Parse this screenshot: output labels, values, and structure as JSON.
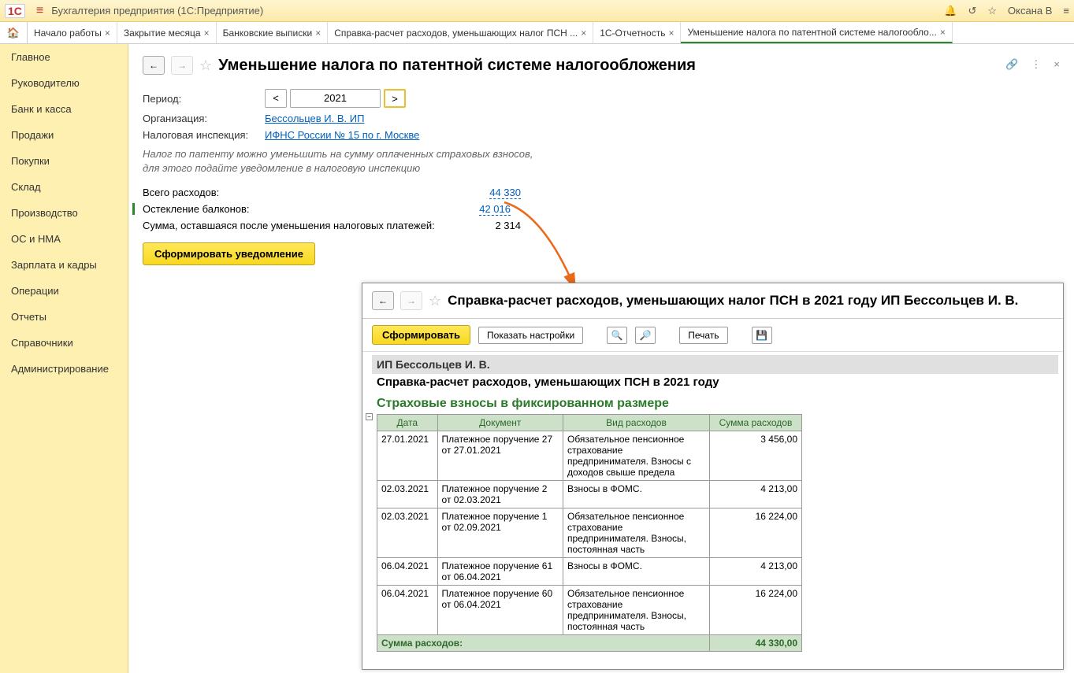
{
  "titlebar": {
    "app_title": "Бухгалтерия предприятия  (1С:Предприятие)",
    "user": "Оксана В"
  },
  "tabs": [
    {
      "label": "Начало работы"
    },
    {
      "label": "Закрытие месяца"
    },
    {
      "label": "Банковские выписки"
    },
    {
      "label": "Справка-расчет расходов, уменьшающих налог ПСН ..."
    },
    {
      "label": "1С-Отчетность"
    },
    {
      "label": "Уменьшение налога по патентной системе налогообло...",
      "active": true
    }
  ],
  "sidebar": {
    "items": [
      "Главное",
      "Руководителю",
      "Банк и касса",
      "Продажи",
      "Покупки",
      "Склад",
      "Производство",
      "ОС и НМА",
      "Зарплата и кадры",
      "Операции",
      "Отчеты",
      "Справочники",
      "Администрирование"
    ]
  },
  "main": {
    "title": "Уменьшение налога по патентной системе налогообложения",
    "period_label": "Период:",
    "period_value": "2021",
    "org_label": "Организация:",
    "org_value": "Бессольцев И. В. ИП",
    "tax_label": "Налоговая инспекция:",
    "tax_value": "ИФНС России № 15 по г. Москве",
    "hint1": "Налог по патенту можно уменьшить на сумму оплаченных страховых взносов,",
    "hint2": "для этого подайте уведомление в налоговую инспекцию",
    "total_exp_label": "Всего расходов:",
    "total_exp_value": "44 330",
    "glazing_label": "Остекление балконов:",
    "glazing_value": "42 016",
    "remain_label": "Сумма, оставшаяся после уменьшения налоговых платежей:",
    "remain_value": "2 314",
    "form_btn": "Сформировать уведомление"
  },
  "overlay": {
    "title": "Справка-расчет расходов, уменьшающих налог ПСН в 2021 году ИП Бессольцев И. В.",
    "btn_form": "Сформировать",
    "btn_settings": "Показать настройки",
    "btn_print": "Печать",
    "r_org": "ИП Бессольцев И. В.",
    "r_title": "Справка-расчет расходов, уменьшающих ПСН в 2021 году",
    "r_section": "Страховые взносы в фиксированном размере",
    "columns": [
      "Дата",
      "Документ",
      "Вид расходов",
      "Сумма расходов"
    ],
    "rows": [
      {
        "date": "27.01.2021",
        "doc": "Платежное поручение 27 от 27.01.2021",
        "kind": "Обязательное пенсионное страхование предпринимателя. Взносы с доходов свыше предела",
        "sum": "3 456,00"
      },
      {
        "date": "02.03.2021",
        "doc": "Платежное поручение 2 от 02.03.2021",
        "kind": "Взносы в ФОМС.",
        "sum": "4 213,00"
      },
      {
        "date": "02.03.2021",
        "doc": "Платежное поручение 1 от 02.09.2021",
        "kind": "Обязательное пенсионное страхование предпринимателя. Взносы, постоянная часть",
        "sum": "16 224,00"
      },
      {
        "date": "06.04.2021",
        "doc": "Платежное поручение 61 от 06.04.2021",
        "kind": "Взносы в ФОМС.",
        "sum": "4 213,00"
      },
      {
        "date": "06.04.2021",
        "doc": "Платежное поручение 60 от 06.04.2021",
        "kind": "Обязательное пенсионное страхование предпринимателя. Взносы, постоянная часть",
        "sum": "16 224,00"
      }
    ],
    "total_label": "Сумма расходов:",
    "total_value": "44 330,00"
  }
}
